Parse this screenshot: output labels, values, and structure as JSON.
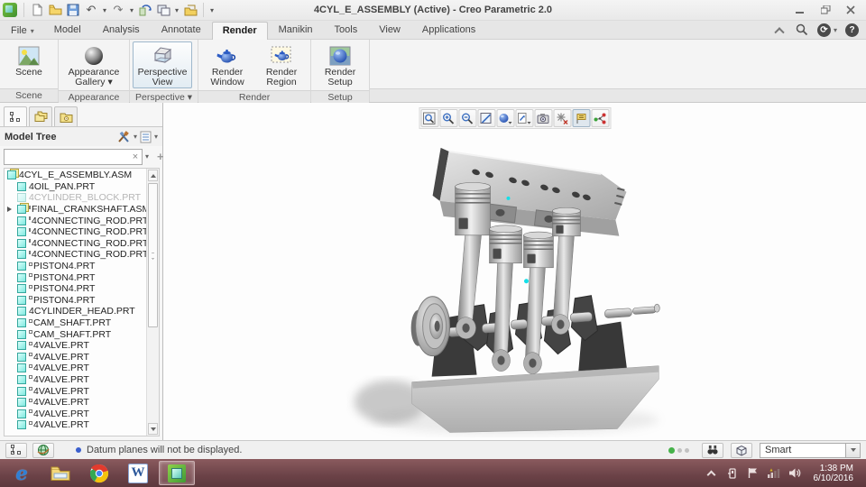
{
  "title_bar": {
    "title": "4CYL_E_ASSEMBLY (Active) - Creo Parametric 2.0"
  },
  "icons": {
    "dropdown": "▾",
    "undo": "↶",
    "redo": "↷",
    "clear": "×",
    "add": "+",
    "help": "?",
    "sync": "⟳",
    "ie_letter": "e",
    "word_letter": "W"
  },
  "tabs": {
    "file_label": "File",
    "items": [
      {
        "label": "Model",
        "name": "tab-model",
        "classes": ""
      },
      {
        "label": "Analysis",
        "name": "tab-analysis",
        "classes": ""
      },
      {
        "label": "Annotate",
        "name": "tab-annotate",
        "classes": ""
      },
      {
        "label": "Render",
        "name": "tab-render",
        "classes": "active"
      },
      {
        "label": "Manikin",
        "name": "tab-manikin",
        "classes": ""
      },
      {
        "label": "Tools",
        "name": "tab-tools",
        "classes": ""
      },
      {
        "label": "View",
        "name": "tab-view",
        "classes": ""
      },
      {
        "label": "Applications",
        "name": "tab-applications",
        "classes": ""
      }
    ]
  },
  "ribbon": {
    "buttons": [
      {
        "line1": "Scene",
        "line2": ""
      },
      {
        "line1": "Appearance",
        "line2": "Gallery ▾"
      },
      {
        "line1": "Perspective",
        "line2": "View"
      },
      {
        "line1": "Render",
        "line2": "Window"
      },
      {
        "line1": "Render",
        "line2": "Region"
      },
      {
        "line1": "Render",
        "line2": "Setup"
      }
    ],
    "groups": [
      {
        "label": "Scene"
      },
      {
        "label": "Appearance"
      },
      {
        "label": "Perspective ▾"
      },
      {
        "label": "Render"
      },
      {
        "label": "Setup"
      }
    ]
  },
  "navigator": {
    "header": "Model Tree",
    "search": {
      "value": ""
    }
  },
  "tree": {
    "items": [
      {
        "label": "4CYL_E_ASSEMBLY.ASM",
        "classes": "root asm"
      },
      {
        "label": "4OIL_PAN.PRT",
        "classes": "prt"
      },
      {
        "label": "4CYLINDER_BLOCK.PRT",
        "classes": "prt dim"
      },
      {
        "label": "FINAL_CRANKSHAFT.ASM",
        "classes": "asm expand marker"
      },
      {
        "label": "4CONNECTING_ROD.PRT",
        "classes": "prt marker"
      },
      {
        "label": "4CONNECTING_ROD.PRT",
        "classes": "prt marker"
      },
      {
        "label": "4CONNECTING_ROD.PRT",
        "classes": "prt marker"
      },
      {
        "label": "4CONNECTING_ROD.PRT",
        "classes": "prt marker"
      },
      {
        "label": "PISTON4.PRT",
        "classes": "prt marker"
      },
      {
        "label": "PISTON4.PRT",
        "classes": "prt marker"
      },
      {
        "label": "PISTON4.PRT",
        "classes": "prt marker"
      },
      {
        "label": "PISTON4.PRT",
        "classes": "prt marker"
      },
      {
        "label": "4CYLINDER_HEAD.PRT",
        "classes": "prt"
      },
      {
        "label": "CAM_SHAFT.PRT",
        "classes": "prt marker"
      },
      {
        "label": "CAM_SHAFT.PRT",
        "classes": "prt marker"
      },
      {
        "label": "4VALVE.PRT",
        "classes": "prt marker"
      },
      {
        "label": "4VALVE.PRT",
        "classes": "prt marker"
      },
      {
        "label": "4VALVE.PRT",
        "classes": "prt marker"
      },
      {
        "label": "4VALVE.PRT",
        "classes": "prt marker"
      },
      {
        "label": "4VALVE.PRT",
        "classes": "prt marker"
      },
      {
        "label": "4VALVE.PRT",
        "classes": "prt marker"
      },
      {
        "label": "4VALVE.PRT",
        "classes": "prt marker"
      },
      {
        "label": "4VALVE.PRT",
        "classes": "prt marker"
      }
    ]
  },
  "status_bar": {
    "message": "Datum planes will not be displayed.",
    "filter_value": "Smart"
  },
  "taskbar": {
    "clock_time": "1:38 PM",
    "clock_date": "6/10/2016"
  },
  "colors": {
    "taskbar": "#6b4247",
    "tree_part_icon": "#7fe8df",
    "accent_blue": "#2a5fc0",
    "status_green": "#46b24a",
    "spin_center_cyan": "#15dfe8"
  }
}
